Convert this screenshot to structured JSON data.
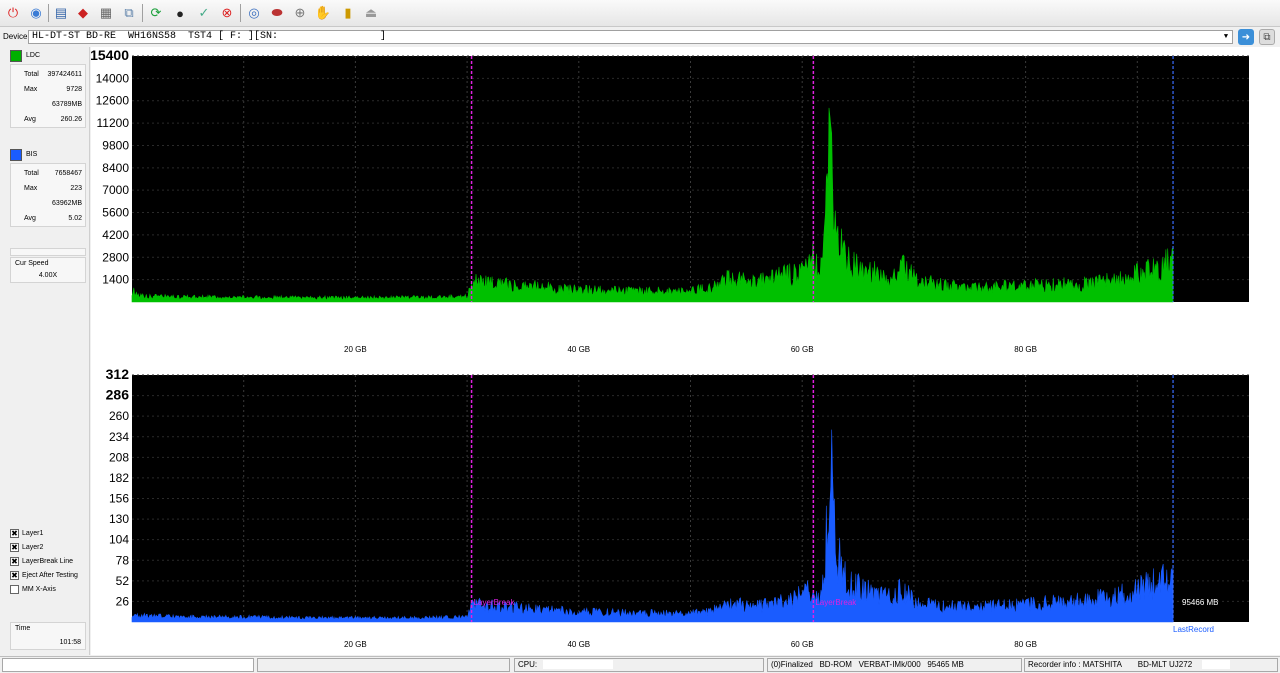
{
  "toolbar": {
    "icons": [
      "power-icon",
      "disc-info-icon",
      "drive-icon",
      "erase-icon",
      "burn-icon",
      "copy-icon",
      "refresh-icon",
      "scan-icon",
      "test-icon",
      "stop-icon",
      "settings-icon",
      "save-icon",
      "print-icon",
      "capture-icon",
      "graph-icon",
      "exit-icon"
    ]
  },
  "device": {
    "label": "Device:",
    "value": "HL-DT-ST BD-RE  WH16NS58  TST4 [ F: ][SN:                 ]"
  },
  "ldc": {
    "label": "LDC",
    "color": "#00b000",
    "total_label": "Total",
    "total": "397424611",
    "max_label": "Max",
    "max": "9728",
    "max_pos": "63789MB",
    "avg_label": "Avg",
    "avg": "260.26"
  },
  "bis": {
    "label": "BIS",
    "color": "#1a5cff",
    "total_label": "Total",
    "total": "7658467",
    "max_label": "Max",
    "max": "223",
    "max_pos": "63962MB",
    "avg_label": "Avg",
    "avg": "5.02"
  },
  "speed": {
    "label": "Cur Speed",
    "value": "4.00X"
  },
  "options": [
    {
      "label": "Layer1",
      "checked": true
    },
    {
      "label": "Layer2",
      "checked": true
    },
    {
      "label": "LayerBreak Line",
      "checked": true
    },
    {
      "label": "Eject After Testing",
      "checked": true
    },
    {
      "label": "MM X-Axis",
      "checked": false
    }
  ],
  "time": {
    "label": "Time",
    "value": "101:58"
  },
  "chart_data": [
    {
      "type": "area",
      "series": [
        {
          "name": "LDC",
          "color": "#00c000"
        }
      ],
      "yticks": [
        "15400",
        "14000",
        "12600",
        "11200",
        "9800",
        "8400",
        "7000",
        "5600",
        "4200",
        "2800",
        "1400"
      ],
      "ylim": [
        0,
        15400
      ],
      "xticks": [
        "20 GB",
        "40 GB",
        "60 GB",
        "80 GB"
      ],
      "xtick_values": [
        20,
        40,
        60,
        80
      ],
      "xlim": [
        0,
        100
      ],
      "layer_breaks_gb": [
        30.4,
        61.0
      ],
      "end_gb": 93.2,
      "profile": [
        [
          0,
          700
        ],
        [
          1,
          350
        ],
        [
          5,
          300
        ],
        [
          10,
          280
        ],
        [
          15,
          270
        ],
        [
          20,
          260
        ],
        [
          25,
          280
        ],
        [
          30,
          330
        ],
        [
          30.5,
          1300
        ],
        [
          33,
          1150
        ],
        [
          36,
          950
        ],
        [
          40,
          750
        ],
        [
          45,
          650
        ],
        [
          50,
          700
        ],
        [
          52,
          850
        ],
        [
          53,
          1400
        ],
        [
          56,
          1200
        ],
        [
          58,
          1600
        ],
        [
          60,
          2000
        ],
        [
          61,
          2700
        ],
        [
          61.5,
          1900
        ],
        [
          62,
          3800
        ],
        [
          62.5,
          9728
        ],
        [
          63,
          4500
        ],
        [
          64,
          2600
        ],
        [
          66,
          1900
        ],
        [
          68,
          1400
        ],
        [
          69,
          2400
        ],
        [
          70,
          1600
        ],
        [
          72,
          1100
        ],
        [
          75,
          900
        ],
        [
          80,
          1000
        ],
        [
          85,
          1100
        ],
        [
          88,
          1300
        ],
        [
          90,
          1700
        ],
        [
          92,
          2100
        ],
        [
          93,
          2600
        ],
        [
          93.2,
          2800
        ]
      ]
    },
    {
      "type": "area",
      "series": [
        {
          "name": "BIS",
          "color": "#1a5cff"
        }
      ],
      "yticks": [
        "312",
        "286",
        "260",
        "234",
        "208",
        "182",
        "156",
        "130",
        "104",
        "78",
        "52",
        "26"
      ],
      "ylim": [
        0,
        312
      ],
      "xticks": [
        "20 GB",
        "40 GB",
        "60 GB",
        "80 GB"
      ],
      "xtick_values": [
        20,
        40,
        60,
        80
      ],
      "xlim": [
        0,
        100
      ],
      "layer_breaks_gb": [
        30.4,
        61.0
      ],
      "end_gb": 93.2,
      "profile": [
        [
          0,
          8
        ],
        [
          5,
          6
        ],
        [
          10,
          6
        ],
        [
          15,
          5
        ],
        [
          20,
          5
        ],
        [
          25,
          5
        ],
        [
          30,
          6
        ],
        [
          30.5,
          22
        ],
        [
          33,
          19
        ],
        [
          36,
          16
        ],
        [
          40,
          13
        ],
        [
          45,
          11
        ],
        [
          50,
          11
        ],
        [
          52,
          14
        ],
        [
          53,
          22
        ],
        [
          56,
          20
        ],
        [
          58,
          24
        ],
        [
          60,
          33
        ],
        [
          61,
          42
        ],
        [
          61.5,
          28
        ],
        [
          62,
          62
        ],
        [
          62.5,
          223
        ],
        [
          63,
          90
        ],
        [
          64,
          48
        ],
        [
          66,
          38
        ],
        [
          68,
          30
        ],
        [
          69,
          40
        ],
        [
          70,
          26
        ],
        [
          72,
          20
        ],
        [
          75,
          18
        ],
        [
          80,
          22
        ],
        [
          85,
          26
        ],
        [
          88,
          32
        ],
        [
          90,
          40
        ],
        [
          92,
          50
        ],
        [
          93,
          56
        ],
        [
          93.2,
          58
        ]
      ],
      "annotations": [
        "LayerBreak",
        "LayerBreak"
      ],
      "end_label": "95466 MB",
      "last_record_label": "LastRecord"
    }
  ],
  "status": {
    "cpu_label": "CPU:",
    "disc_info": "(0)Finalized   BD-ROM   VERBAT-IMk/000   95465 MB",
    "recorder_label": "Recorder info  : MATSHITA",
    "recorder_model": "BD-MLT UJ272"
  }
}
